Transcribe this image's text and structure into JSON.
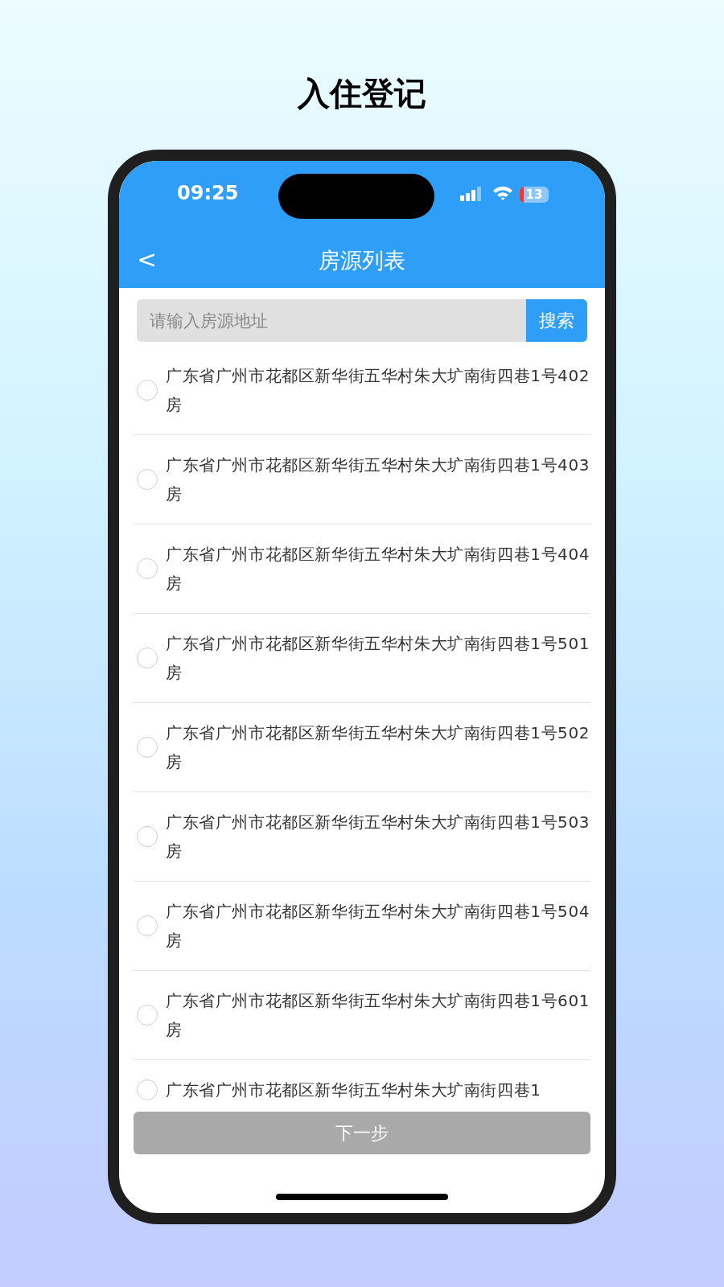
{
  "page_title": "入住登记",
  "status_bar": {
    "time": "09:25",
    "battery": "13"
  },
  "nav_bar": {
    "back": "<",
    "title": "房源列表"
  },
  "search": {
    "placeholder": "请输入房源地址",
    "button": "搜索"
  },
  "listings": [
    {
      "address": "广东省广州市花都区新华街五华村朱大圹南街四巷1号402房",
      "selected": false
    },
    {
      "address": "广东省广州市花都区新华街五华村朱大圹南街四巷1号403房",
      "selected": false
    },
    {
      "address": "广东省广州市花都区新华街五华村朱大圹南街四巷1号404房",
      "selected": false
    },
    {
      "address": "广东省广州市花都区新华街五华村朱大圹南街四巷1号501房",
      "selected": false
    },
    {
      "address": "广东省广州市花都区新华街五华村朱大圹南街四巷1号502房",
      "selected": false
    },
    {
      "address": "广东省广州市花都区新华街五华村朱大圹南街四巷1号503房",
      "selected": false
    },
    {
      "address": "广东省广州市花都区新华街五华村朱大圹南街四巷1号504房",
      "selected": false
    },
    {
      "address": "广东省广州市花都区新华街五华村朱大圹南街四巷1号601房",
      "selected": false
    },
    {
      "address": "广东省广州市花都区新华街五华村朱大圹南街四巷1",
      "selected": false
    }
  ],
  "next_button": {
    "label": "下一步",
    "disabled": true
  }
}
